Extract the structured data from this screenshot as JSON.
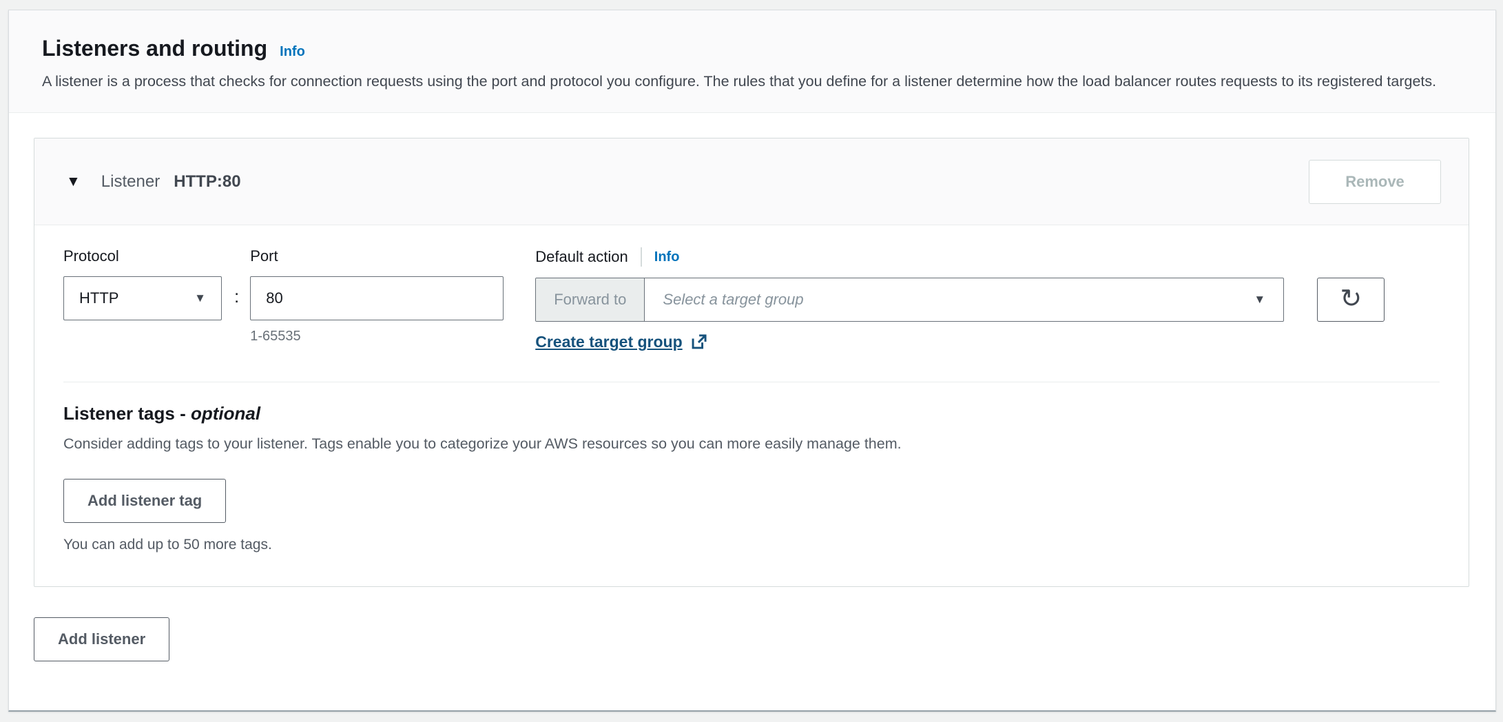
{
  "section": {
    "title": "Listeners and routing",
    "info_label": "Info",
    "description": "A listener is a process that checks for connection requests using the port and protocol you configure. The rules that you define for a listener determine how the load balancer routes requests to its registered targets."
  },
  "listener_card": {
    "label": "Listener",
    "name": "HTTP:80",
    "remove_label": "Remove",
    "protocol": {
      "label": "Protocol",
      "value": "HTTP"
    },
    "separator": ":",
    "port": {
      "label": "Port",
      "value": "80",
      "hint": "1-65535"
    },
    "default_action": {
      "label": "Default action",
      "info_label": "Info",
      "prefix": "Forward to",
      "placeholder": "Select a target group",
      "create_link_label": "Create target group"
    },
    "tags": {
      "title": "Listener tags",
      "separator": "- ",
      "optional_label": "optional",
      "description": "Consider adding tags to your listener. Tags enable you to categorize your AWS resources so you can more easily manage them.",
      "add_button_label": "Add listener tag",
      "hint": "You can add up to 50 more tags."
    }
  },
  "add_listener_label": "Add listener",
  "icons": {
    "caret_down": "▼",
    "refresh": "↻"
  },
  "colors": {
    "info_link": "#0073bb",
    "dark_link": "#16527c",
    "input_border": "#687078",
    "disabled_text": "#aab7b8",
    "secondary_text": "#545b64"
  }
}
